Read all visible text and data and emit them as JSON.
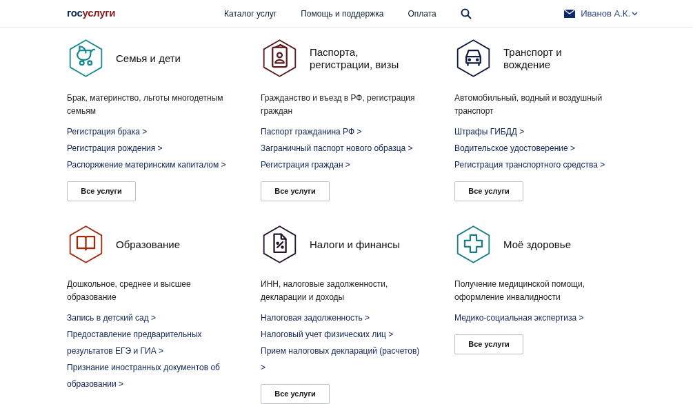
{
  "header": {
    "logo_prefix": "гос",
    "logo_suffix": "услуги",
    "nav": [
      "Каталог услуг",
      "Помощь и поддержка",
      "Оплата"
    ],
    "user": "Иванов А.К."
  },
  "categories": [
    {
      "kind": "stroller",
      "color": "#1a8a91",
      "title": "Семья и дети",
      "description": "Брак, материнство, льготы многодетным семьям",
      "links": [
        "Регистрация брака >",
        "Регистрация рождения >",
        "Распоряжение материнским капиталом >"
      ],
      "button": "Все услуги"
    },
    {
      "kind": "passport",
      "color": "#5a1a1e",
      "title": "Паспорта, регистрации, визы",
      "description": "Гражданство и въезд в РФ, регистрация граждан",
      "links": [
        "Паспорт гражданина РФ >",
        "Заграничный паспорт нового образца >",
        "Регистрация граждан >"
      ],
      "button": "Все услуги"
    },
    {
      "kind": "car",
      "color": "#0f1b3d",
      "title": "Транспорт и вождение",
      "description": "Автомобильный, водный и воздушный транспорт",
      "links": [
        "Штрафы ГИБДД >",
        "Водительское удостоверение >",
        "Регистрация транспортного средства >"
      ],
      "button": "Все услуги"
    },
    {
      "kind": "book",
      "color": "#a02a0c",
      "title": "Образование",
      "description": "Дошкольное, среднее и высшее образование",
      "links": [
        "Запись в детский сад >",
        "Предоставление предварительных результатов ЕГЭ и ГИА >",
        "Признание иностранных документов об образовании >"
      ]
    },
    {
      "kind": "tax",
      "color": "#25152a",
      "title": "Налоги и финансы",
      "description": "ИНН, налоговые задолженности, декларации и доходы",
      "links": [
        "Налоговая задолженность >",
        "Налоговый учет физических лиц >",
        "Прием налоговых деклараций (расчетов) >"
      ],
      "button": "Все услуги"
    },
    {
      "kind": "cross",
      "color": "#1a7d86",
      "title": "Моё здоровье",
      "description": "Получение медицинской помощи, оформление инвалидности",
      "links": [
        "Медико-социальная экспертиза >"
      ],
      "button": "Все услуги"
    }
  ]
}
